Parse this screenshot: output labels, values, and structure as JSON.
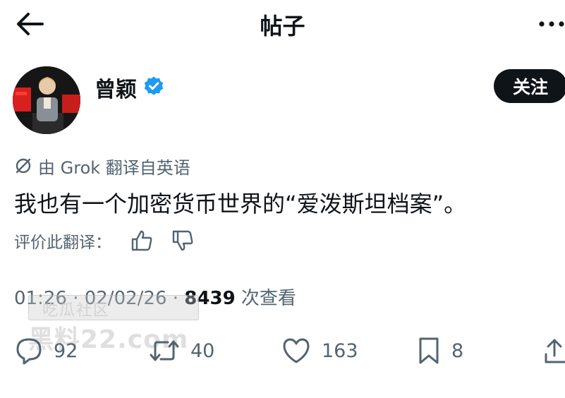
{
  "header": {
    "title": "帖子",
    "back_icon": "arrow-left-icon",
    "more_icon": "more-horizontal-icon"
  },
  "author": {
    "name": "曾颖",
    "verified_color": "#1d9bf0",
    "follow_label": "关注"
  },
  "translation": {
    "notice": "由 Grok 翻译自英语",
    "rate_label": "评价此翻译："
  },
  "post": {
    "text": "我也有一个加密货币世界的“爱泼斯坦档案”。"
  },
  "meta": {
    "time": "01:26 · 02/02/26 · ",
    "views": "8439",
    "views_label": " 次查看"
  },
  "watermark": {
    "line1": "吃瓜社区",
    "line2": "黑料22.com"
  },
  "actions": {
    "replies": "92",
    "reposts": "40",
    "likes": "163",
    "bookmarks": "8"
  },
  "colors": {
    "text": "#0f1419",
    "muted": "#536471",
    "button_bg": "#0f1419",
    "verified": "#1d9bf0"
  }
}
